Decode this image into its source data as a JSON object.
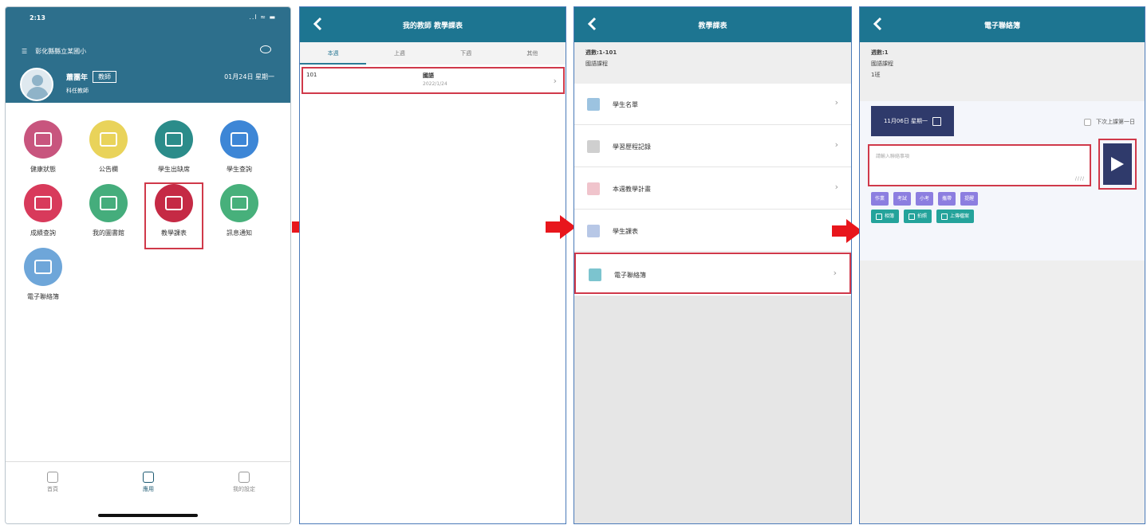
{
  "screen1": {
    "status_time": "2:13",
    "status_icons": "..l ≈ ▬",
    "school": "彰化縣縣立某國小",
    "teacher_name": "蕭團年",
    "role": "教師",
    "date": "01月24日 星期一",
    "department": "科任教師",
    "tiles": [
      {
        "label": "健康狀態",
        "color": "#c8557e"
      },
      {
        "label": "公告欄",
        "color": "#e9d35a"
      },
      {
        "label": "學生出缺席",
        "color": "#2b8c8a"
      },
      {
        "label": "學生查詢",
        "color": "#3d86d6"
      },
      {
        "label": "成績查詢",
        "color": "#d83a5b"
      },
      {
        "label": "我的圖書館",
        "color": "#45ad7c"
      },
      {
        "label": "教學課表",
        "color": "#c52a45"
      },
      {
        "label": "訊息通知",
        "color": "#47b07b"
      },
      {
        "label": "電子聯絡簿",
        "color": "#6ea6d9"
      }
    ],
    "tabbar": [
      "首頁",
      "應用",
      "我的設定"
    ]
  },
  "screen2": {
    "title": "我的教師 教學課表",
    "tabs": [
      "本週",
      "上週",
      "下週",
      "其他"
    ],
    "row_code": "101",
    "row_name": "國語",
    "row_sub": "2022/1/24"
  },
  "screen3": {
    "title": "教學課表",
    "info_a": "週數:1-101",
    "info_b": "國語課程",
    "items": [
      "學生名單",
      "學習歷程記錄",
      "本週教學計畫",
      "學生課表",
      "電子聯絡簿"
    ],
    "item_colors": [
      "#9cc3e0",
      "#cfcfcf",
      "#f0c4cc",
      "#b7c7e6",
      "#7cc4cf"
    ]
  },
  "screen4": {
    "title": "電子聯絡簿",
    "info": [
      "週數:1",
      "國語課程",
      "1班"
    ],
    "date_button": "11月06日 星期一",
    "next_day": "下次上課第一日",
    "placeholder": "請輸入聯絡事項",
    "quick_chips": [
      "作業",
      "考試",
      "小考",
      "攜帶",
      "提醒"
    ],
    "action_buttons": [
      "相簿",
      "拍照",
      "上傳檔案"
    ]
  }
}
